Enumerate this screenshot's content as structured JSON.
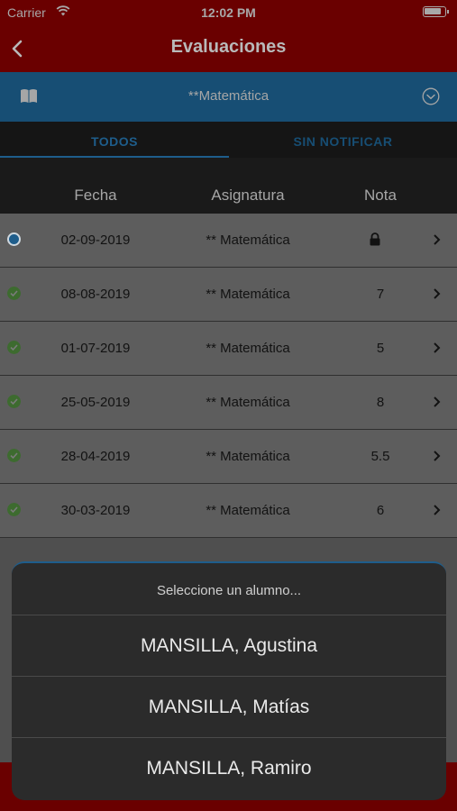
{
  "status_bar": {
    "carrier": "Carrier",
    "time": "12:02 PM"
  },
  "nav": {
    "title": "Evaluaciones",
    "back_icon": "chevron-left-icon"
  },
  "subject_selector": {
    "value": "**Matemática",
    "icon": "book-icon",
    "dropdown_icon": "chevron-down-circle-icon"
  },
  "tabs": [
    {
      "label": "TODOS",
      "active": true
    },
    {
      "label": "SIN NOTIFICAR",
      "active": false
    }
  ],
  "table": {
    "headers": {
      "date": "Fecha",
      "subject": "Asignatura",
      "grade": "Nota"
    },
    "rows": [
      {
        "date": "02-09-2019",
        "subject": "** Matemática",
        "grade": "",
        "locked": true,
        "status": "pending"
      },
      {
        "date": "08-08-2019",
        "subject": "** Matemática",
        "grade": "7",
        "locked": false,
        "status": "notified"
      },
      {
        "date": "01-07-2019",
        "subject": "** Matemática",
        "grade": "5",
        "locked": false,
        "status": "notified"
      },
      {
        "date": "25-05-2019",
        "subject": "** Matemática",
        "grade": "8",
        "locked": false,
        "status": "notified"
      },
      {
        "date": "28-04-2019",
        "subject": "** Matemática",
        "grade": "5.5",
        "locked": false,
        "status": "notified"
      },
      {
        "date": "30-03-2019",
        "subject": "** Matemática",
        "grade": "6",
        "locked": false,
        "status": "notified"
      }
    ]
  },
  "student_sheet": {
    "prompt": "Seleccione un alumno...",
    "options": [
      "MANSILLA, Agustina",
      "MANSILLA, Matías",
      "MANSILLA, Ramiro"
    ]
  },
  "colors": {
    "header_red": "#6a0000",
    "selector_blue": "#174e74",
    "pending_dot": "#1e5d8b",
    "notified_dot": "#3d6b2f"
  }
}
